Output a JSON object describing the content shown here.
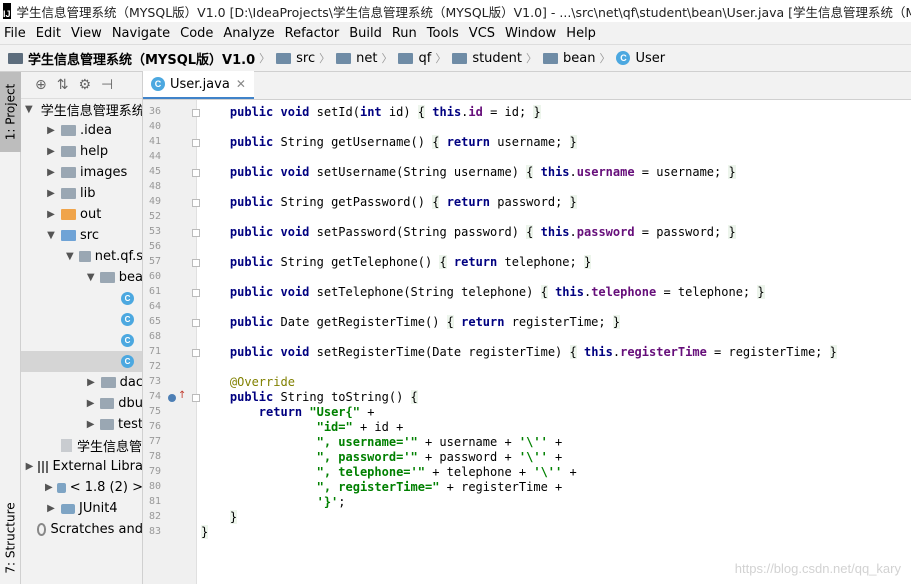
{
  "window": {
    "title": "学生信息管理系统（MYSQL版）V1.0 [D:\\IdeaProjects\\学生信息管理系统（MYSQL版）V1.0] - ...\\src\\net\\qf\\student\\bean\\User.java [学生信息管理系统（MYSQL版"
  },
  "menu": [
    "File",
    "Edit",
    "View",
    "Navigate",
    "Code",
    "Analyze",
    "Refactor",
    "Build",
    "Run",
    "Tools",
    "VCS",
    "Window",
    "Help"
  ],
  "breadcrumb": [
    "学生信息管理系统（MYSQL版）V1.0",
    "src",
    "net",
    "qf",
    "student",
    "bean",
    "User"
  ],
  "sidebar": {
    "project_tab": "1: Project",
    "structure_tab": "7: Structure"
  },
  "tree": [
    {
      "label": "学生信息管理系统",
      "indent": 0,
      "arrow": "down",
      "icon": "project"
    },
    {
      "label": ".idea",
      "indent": 1,
      "arrow": "right",
      "icon": "folder"
    },
    {
      "label": "help",
      "indent": 1,
      "arrow": "right",
      "icon": "folder"
    },
    {
      "label": "images",
      "indent": 1,
      "arrow": "right",
      "icon": "folder"
    },
    {
      "label": "lib",
      "indent": 1,
      "arrow": "right",
      "icon": "folder"
    },
    {
      "label": "out",
      "indent": 1,
      "arrow": "right",
      "icon": "folder-orange"
    },
    {
      "label": "src",
      "indent": 1,
      "arrow": "down",
      "icon": "folder-blue"
    },
    {
      "label": "net.qf.s",
      "indent": 2,
      "arrow": "down",
      "icon": "folder"
    },
    {
      "label": "bea",
      "indent": 3,
      "arrow": "down",
      "icon": "folder"
    },
    {
      "label": "",
      "indent": 4,
      "arrow": "",
      "icon": "class"
    },
    {
      "label": "",
      "indent": 4,
      "arrow": "",
      "icon": "class"
    },
    {
      "label": "",
      "indent": 4,
      "arrow": "",
      "icon": "class"
    },
    {
      "label": "",
      "indent": 4,
      "arrow": "",
      "icon": "class",
      "selected": true
    },
    {
      "label": "dac",
      "indent": 3,
      "arrow": "right",
      "icon": "folder"
    },
    {
      "label": "dbu",
      "indent": 3,
      "arrow": "right",
      "icon": "folder"
    },
    {
      "label": "test",
      "indent": 3,
      "arrow": "right",
      "icon": "folder"
    },
    {
      "label": "学生信息管",
      "indent": 1,
      "arrow": "",
      "icon": "file"
    },
    {
      "label": "External Libra",
      "indent": 0,
      "arrow": "right",
      "icon": "libs"
    },
    {
      "label": "< 1.8 (2) >",
      "indent": 1,
      "arrow": "right",
      "icon": "jar"
    },
    {
      "label": "JUnit4",
      "indent": 1,
      "arrow": "right",
      "icon": "jar"
    },
    {
      "label": "Scratches and",
      "indent": 0,
      "arrow": "",
      "icon": "scratch"
    }
  ],
  "editor": {
    "tab_label": "User.java",
    "line_numbers": [
      "36",
      "40",
      "41",
      "44",
      "45",
      "48",
      "49",
      "52",
      "53",
      "56",
      "57",
      "60",
      "61",
      "64",
      "65",
      "68",
      "71",
      "72",
      "73",
      "74",
      "75",
      "76",
      "77",
      "78",
      "79",
      "80",
      "81",
      "82",
      "83"
    ],
    "lines": [
      "    public void setId(int id) { this.id = id; }",
      "",
      "    public String getUsername() { return username; }",
      "",
      "    public void setUsername(String username) { this.username = username; }",
      "",
      "    public String getPassword() { return password; }",
      "",
      "    public void setPassword(String password) { this.password = password; }",
      "",
      "    public String getTelephone() { return telephone; }",
      "",
      "    public void setTelephone(String telephone) { this.telephone = telephone; }",
      "",
      "    public Date getRegisterTime() { return registerTime; }",
      "",
      "    public void setRegisterTime(Date registerTime) { this.registerTime = registerTime; }",
      "",
      "    @Override",
      "    public String toString() {",
      "        return \"User{\" +",
      "                \"id=\" + id +",
      "                \", username='\" + username + '\\'' +",
      "                \", password='\" + password + '\\'' +",
      "                \", telephone='\" + telephone + '\\'' +",
      "                \", registerTime=\" + registerTime +",
      "                '}';",
      "    }",
      "}"
    ]
  },
  "watermark": "https://blog.csdn.net/qq_kary"
}
